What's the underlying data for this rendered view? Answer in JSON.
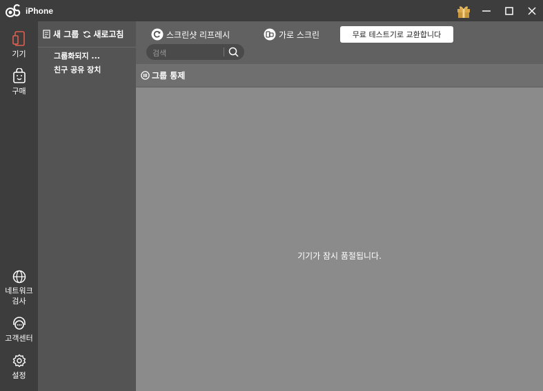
{
  "app": {
    "logo_text": "iPhone"
  },
  "nav": {
    "devices": "기기",
    "purchase": "구매",
    "network_check_1": "네트워크",
    "network_check_2": "검사",
    "support": "고객센터",
    "settings": "설정"
  },
  "groups": {
    "new_group": "새 그룹",
    "refresh": "새로고침",
    "items": [
      "그룹화되지 ...",
      "친구 공유 장치"
    ]
  },
  "toolbar": {
    "screenshot_refresh": "스크린샷 리프레시",
    "landscape": "가로 스크린",
    "promo": "무료 테스트기로 교환합니다",
    "search_placeholder": "검색"
  },
  "group_control": "그룹 통제",
  "empty_message": "기기가 잠시 품절됩니다.",
  "colors": {
    "nav_active": "#e06050",
    "gift": "#d9a84a"
  }
}
